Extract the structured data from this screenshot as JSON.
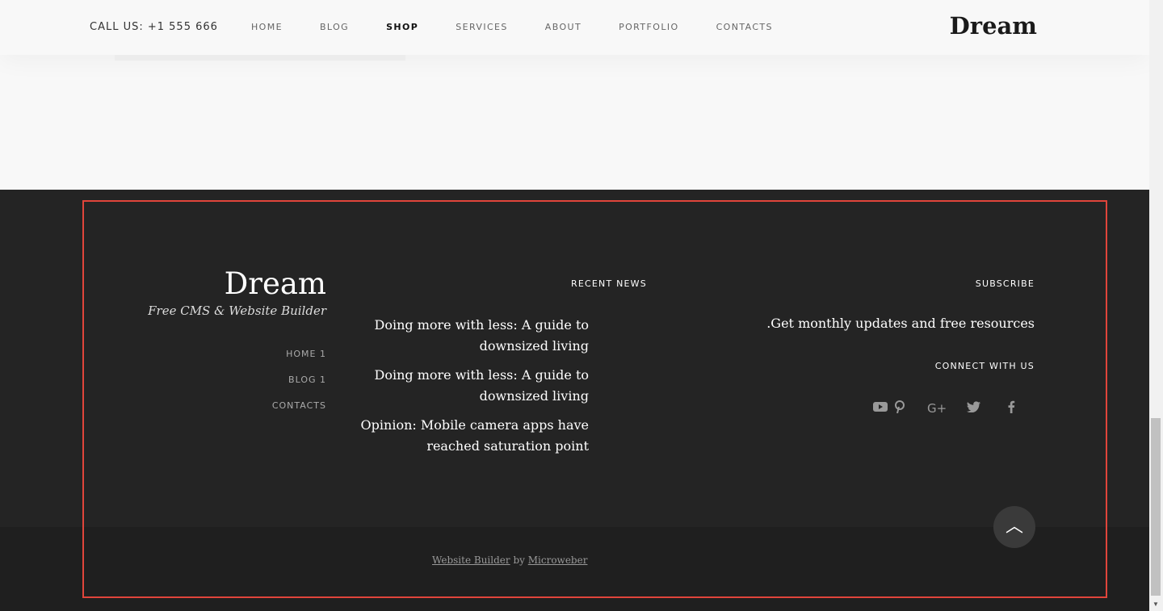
{
  "header": {
    "call": "CALL US: +1 555 666",
    "nav": [
      "HOME",
      "BLOG",
      "SHOP",
      "SERVICES",
      "ABOUT",
      "PORTFOLIO",
      "CONTACTS"
    ],
    "active_nav": "SHOP",
    "logo": "Dream"
  },
  "footer": {
    "logo": "Dream",
    "tagline": "Free CMS & Website Builder",
    "links": [
      "HOME 1",
      "BLOG 1",
      "CONTACTS"
    ],
    "recent_news_heading": "RECENT NEWS",
    "news": [
      "Doing more with less: A guide to downsized living",
      "Doing more with less: A guide to downsized living",
      "Opinion: Mobile camera apps have reached saturation point"
    ],
    "subscribe_heading": "SUBSCRIBE",
    "subscribe_text": ".Get monthly updates and free resources",
    "connect_heading": "CONNECT WITH US",
    "social_icons": [
      "youtube-icon",
      "pinterest-icon",
      "google-plus-icon",
      "twitter-icon",
      "facebook-icon"
    ],
    "credit_link1": "Website Builder",
    "credit_by": "by",
    "credit_link2": "Microweber"
  },
  "colors": {
    "footer_bg": "#242424",
    "highlight": "#e0453b"
  }
}
